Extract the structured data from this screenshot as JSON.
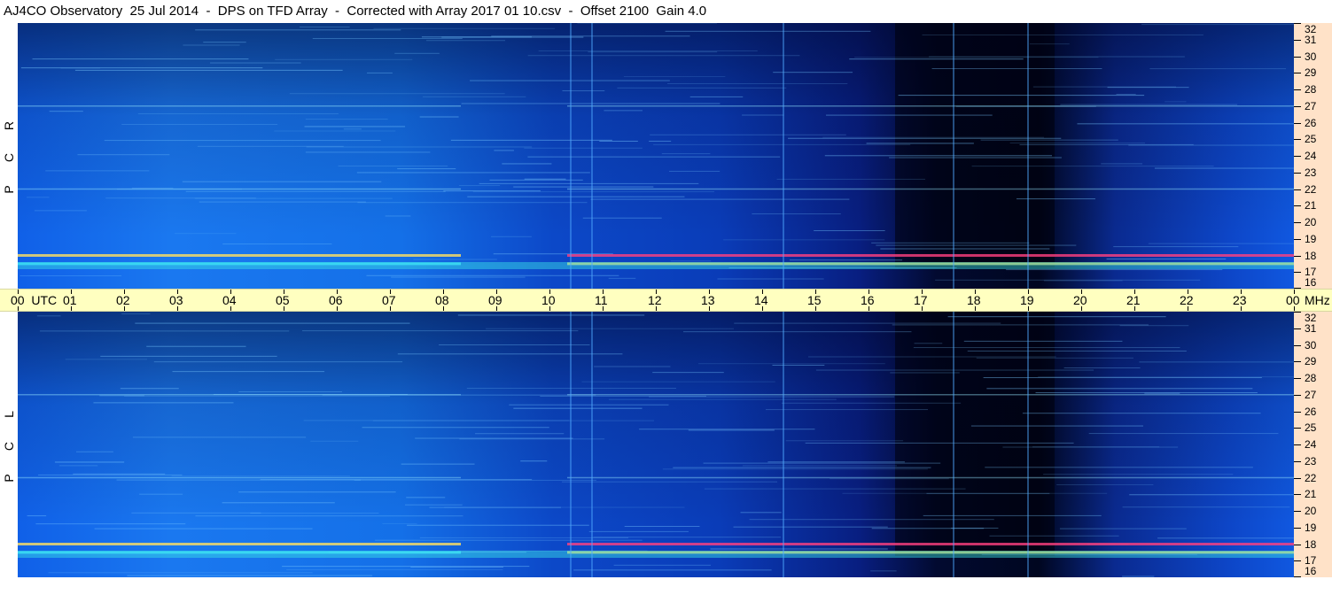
{
  "title": "AJ4CO Observatory  25 Jul 2014  -  DPS on TFD Array  -  Corrected with Array 2017 01 10.csv  -  Offset 2100  Gain 4.0",
  "panels": [
    {
      "id": "rcp",
      "letters": [
        "R",
        "C",
        "P"
      ]
    },
    {
      "id": "lcp",
      "letters": [
        "L",
        "C",
        "P"
      ]
    }
  ],
  "time_axis": {
    "labels": [
      "00  UTC",
      "01",
      "02",
      "03",
      "04",
      "05",
      "06",
      "07",
      "08",
      "09",
      "10",
      "11",
      "12",
      "13",
      "14",
      "15",
      "16",
      "17",
      "18",
      "19",
      "20",
      "21",
      "22",
      "23",
      "00"
    ],
    "unit": "MHz"
  },
  "freq_axis": {
    "labels": [
      "32",
      "31",
      "30",
      "29",
      "28",
      "27",
      "26",
      "25",
      "24",
      "23",
      "22",
      "21",
      "20",
      "19",
      "18",
      "17",
      "16"
    ]
  },
  "colors": {
    "background_dark": "#000830",
    "background_mid": "#0a3ccc",
    "background_light": "#1e90ff",
    "axis_bg": "#ffe2c8",
    "time_bar_bg": "#ffffc0"
  },
  "chart_data": {
    "type": "heatmap",
    "title": "AJ4CO Observatory  25 Jul 2014  -  DPS on TFD Array  -  Corrected with Array 2017 01 10.csv  -  Offset 2100  Gain 4.0",
    "xlabel": "UTC",
    "ylabel": "MHz",
    "x_range": [
      "00",
      "00"
    ],
    "ylim": [
      16,
      32
    ],
    "series": [
      {
        "name": "R C P",
        "bright_bands_mhz": [
          17.5,
          18.0,
          22.0,
          27.0
        ],
        "dark_interval_utc": [
          16.5,
          19.5
        ]
      },
      {
        "name": "L C P",
        "bright_bands_mhz": [
          17.5,
          18.0,
          22.0,
          27.0
        ],
        "dark_interval_utc": [
          16.5,
          19.5
        ]
      }
    ]
  }
}
